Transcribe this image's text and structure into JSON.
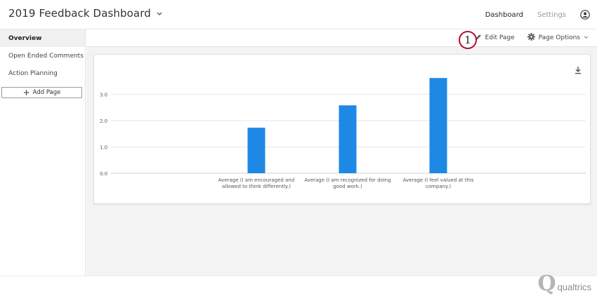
{
  "header": {
    "title": "2019 Feedback Dashboard",
    "nav": {
      "dashboard": "Dashboard",
      "settings": "Settings"
    },
    "icons": {
      "title_chevron": "chevron-down-icon",
      "user": "user-circle-icon"
    }
  },
  "sidebar": {
    "items": [
      {
        "label": "Overview",
        "active": true
      },
      {
        "label": "Open Ended Comments",
        "active": false
      },
      {
        "label": "Action Planning",
        "active": false
      }
    ],
    "add_page_label": "Add Page"
  },
  "toolbar": {
    "annotation_number": "1",
    "edit_page_label": "Edit Page",
    "page_options_label": "Page Options",
    "icons": {
      "edit": "pencil-icon",
      "options": "gear-icon",
      "options_chevron": "chevron-down-icon",
      "download": "download-icon"
    }
  },
  "colors": {
    "bar": "#1e88e5",
    "annotation_ring": "#b3122a",
    "active_sidebar": "#f0f0f0"
  },
  "chart_data": {
    "type": "bar",
    "categories": [
      [
        "Average (I am encouraged and",
        "allowed to think differently.)"
      ],
      [
        "Average (I am recognized for doing",
        "good work.)"
      ],
      [
        "Average (I feel valued at this",
        "company.)"
      ]
    ],
    "values": [
      1.73,
      2.58,
      3.62
    ],
    "yticks": [
      "0.0",
      "1.0",
      "2.0",
      "3.0"
    ],
    "ylim": [
      0,
      4
    ],
    "grid": true,
    "title": "",
    "xlabel": "",
    "ylabel": ""
  },
  "footer": {
    "brand": "qualtrics"
  }
}
